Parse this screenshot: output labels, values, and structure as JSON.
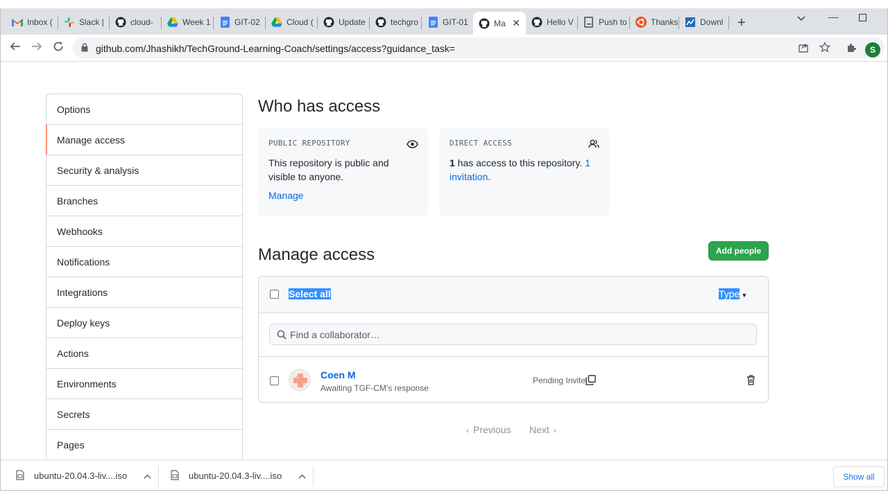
{
  "browser": {
    "tabs": [
      {
        "title": "Inbox (",
        "icon": "gmail-icon"
      },
      {
        "title": "Slack |",
        "icon": "slack-icon"
      },
      {
        "title": "cloud-",
        "icon": "github-icon"
      },
      {
        "title": "Week 1",
        "icon": "google-drive-icon"
      },
      {
        "title": "GIT-02",
        "icon": "google-docs-icon"
      },
      {
        "title": "Cloud (",
        "icon": "google-drive-icon"
      },
      {
        "title": "Update",
        "icon": "github-icon"
      },
      {
        "title": "techgro",
        "icon": "github-icon"
      },
      {
        "title": "GIT-01",
        "icon": "google-docs-icon"
      },
      {
        "title": "Ma",
        "icon": "github-icon",
        "active": true
      },
      {
        "title": "Hello V",
        "icon": "github-icon"
      },
      {
        "title": "Push to",
        "icon": "page-icon"
      },
      {
        "title": "Thanks",
        "icon": "ubuntu-icon"
      },
      {
        "title": "Downl",
        "icon": "download-page-icon"
      }
    ],
    "url": "github.com/Jhashikh/TechGround-Learning-Coach/settings/access?guidance_task=",
    "profile_initial": "S"
  },
  "sidebar": {
    "items": [
      {
        "label": "Options"
      },
      {
        "label": "Manage access",
        "selected": true
      },
      {
        "label": "Security & analysis"
      },
      {
        "label": "Branches"
      },
      {
        "label": "Webhooks"
      },
      {
        "label": "Notifications"
      },
      {
        "label": "Integrations"
      },
      {
        "label": "Deploy keys"
      },
      {
        "label": "Actions"
      },
      {
        "label": "Environments"
      },
      {
        "label": "Secrets"
      },
      {
        "label": "Pages"
      }
    ]
  },
  "who_has_access": {
    "title": "Who has access",
    "public_card": {
      "label": "PUBLIC REPOSITORY",
      "text": "This repository is public and visible to anyone.",
      "link": "Manage"
    },
    "direct_card": {
      "label": "DIRECT ACCESS",
      "count": "1",
      "text": " has access to this repository. ",
      "invite_link": "1 invitation",
      "period": "."
    }
  },
  "manage_access": {
    "title": "Manage access",
    "add_button": "Add people",
    "select_all": "Select all",
    "type_filter": "Type",
    "search_placeholder": "Find a collaborator…",
    "members": [
      {
        "name": "Coen M",
        "subtitle": "Awaiting TGF-CM's response",
        "status": "Pending Invite"
      }
    ],
    "pagination": {
      "previous": "Previous",
      "next": "Next"
    }
  },
  "downloads": {
    "items": [
      {
        "filename": "ubuntu-20.04.3-liv....iso"
      },
      {
        "filename": "ubuntu-20.04.3-liv....iso"
      }
    ],
    "show_all": "Show all"
  },
  "colors": {
    "accent": "#0969da",
    "primary_button": "#2da44e",
    "selected_nav_indicator": "#fd8c73",
    "selection_highlight": "#3390ff"
  }
}
